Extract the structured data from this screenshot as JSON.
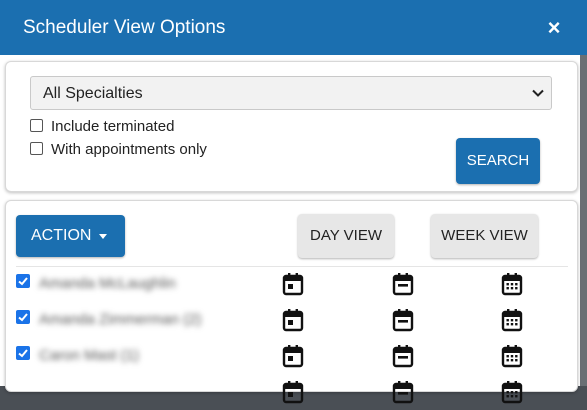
{
  "modal": {
    "title": "Scheduler View Options",
    "close_symbol": "×"
  },
  "filters": {
    "specialty_selected": "All Specialties",
    "include_terminated_label": "Include terminated",
    "include_terminated_checked": false,
    "appointments_only_label": "With appointments only",
    "appointments_only_checked": false,
    "search_label": "SEARCH"
  },
  "toolbar": {
    "action_label": "ACTION",
    "day_view_label": "DAY VIEW",
    "week_view_label": "WEEK VIEW"
  },
  "providers": [
    {
      "name": "Amanda McLaughlin",
      "checked": true
    },
    {
      "name": "Amanda Zimmerman (2)",
      "checked": true
    },
    {
      "name": "Caron Mast (1)",
      "checked": true
    }
  ],
  "icons": {
    "day": "calendar-day-icon",
    "week": "calendar-week-icon",
    "month": "calendar-month-icon"
  },
  "colors": {
    "primary": "#1b6fb0",
    "checkbox": "#1a73e8",
    "secondary_button": "#e7e7e7"
  }
}
